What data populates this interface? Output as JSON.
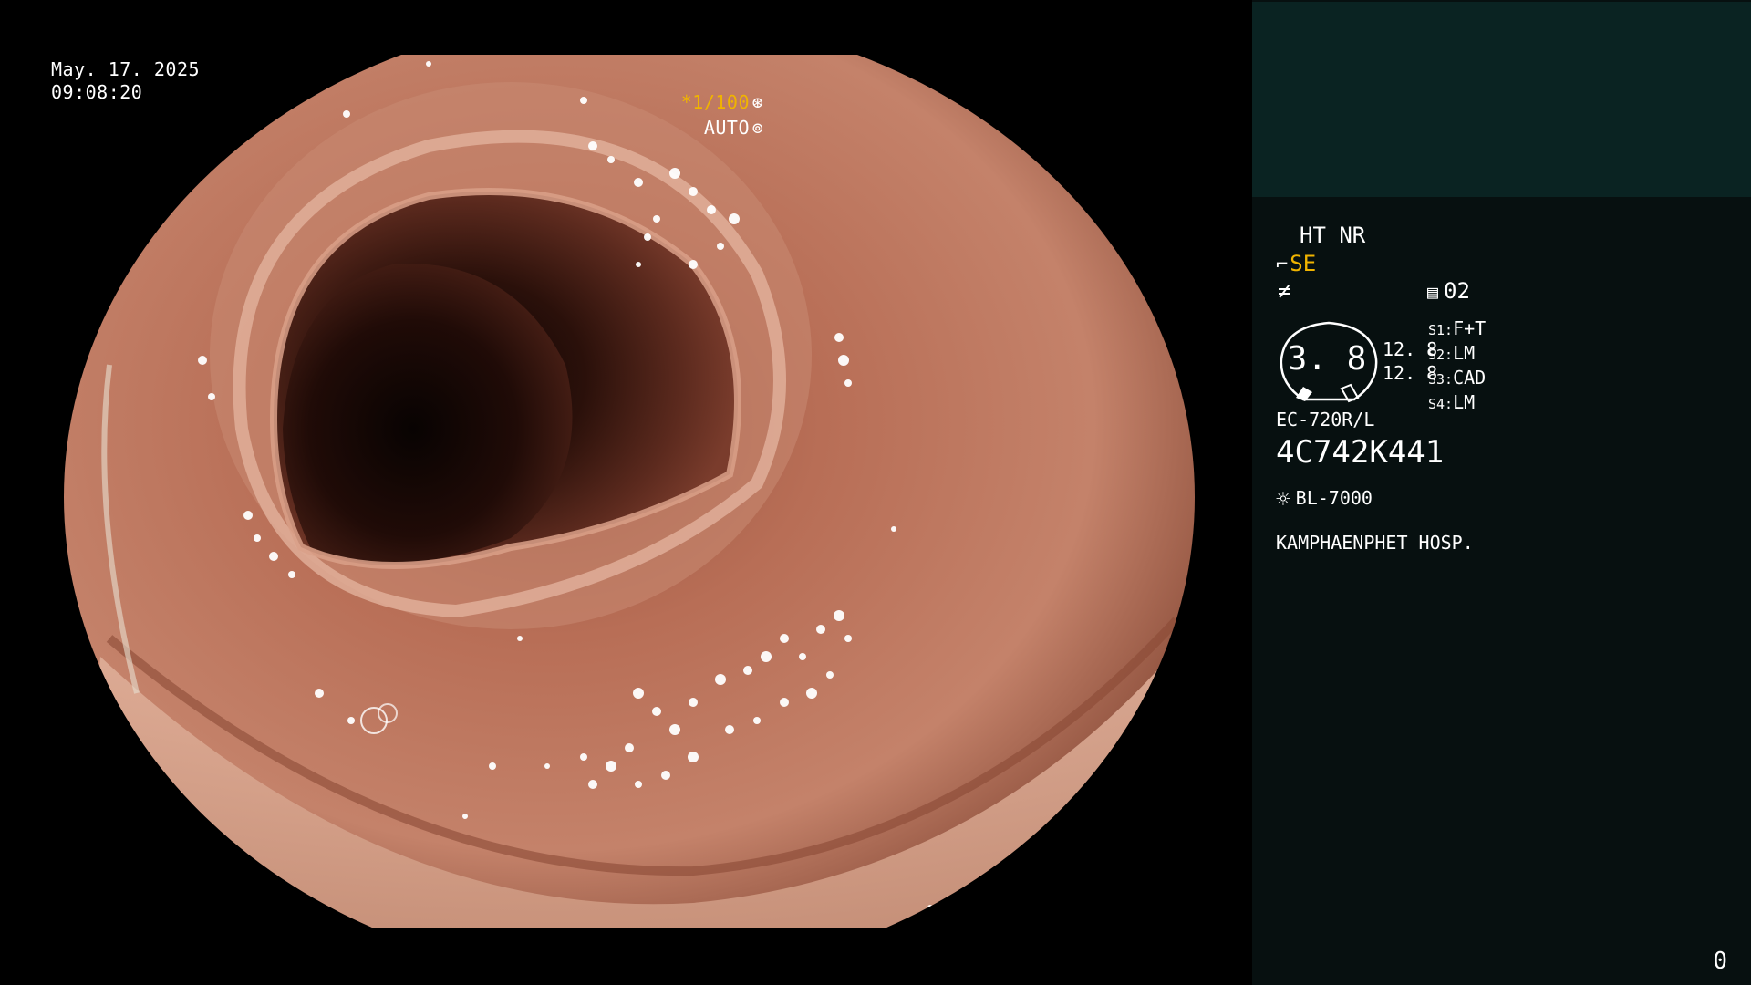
{
  "overlay": {
    "date": "May. 17. 2025",
    "time": "09:08:20",
    "shutter": "*1/100",
    "shutter_icon": "aperture-icon",
    "exposure_mode": "AUTO",
    "exposure_icon": "iris-icon"
  },
  "panel": {
    "enhance_mode": "HT NR",
    "se_label": "SE",
    "media_count": "02",
    "zoom": {
      "value": "3. 8",
      "top_value": "12. 8",
      "bottom_value": "12. 8"
    },
    "switches": [
      {
        "key": "S1:",
        "value": "F+T"
      },
      {
        "key": "S2:",
        "value": "LM"
      },
      {
        "key": "S3:",
        "value": "CAD"
      },
      {
        "key": "S4:",
        "value": "LM"
      }
    ],
    "scope_model": "EC-720R/L",
    "serial_number": "4C742K441",
    "light_source": "BL-7000",
    "hospital": "KAMPHAENPHET HOSP.",
    "counter": "0"
  },
  "colors": {
    "tissue_base": "#b8735c",
    "tissue_dark": "#6e3527",
    "lumen": "#1a0a06",
    "highlight": "#f0b400",
    "panel_bg": "#071010",
    "thumb_bg": "#0a2322"
  }
}
